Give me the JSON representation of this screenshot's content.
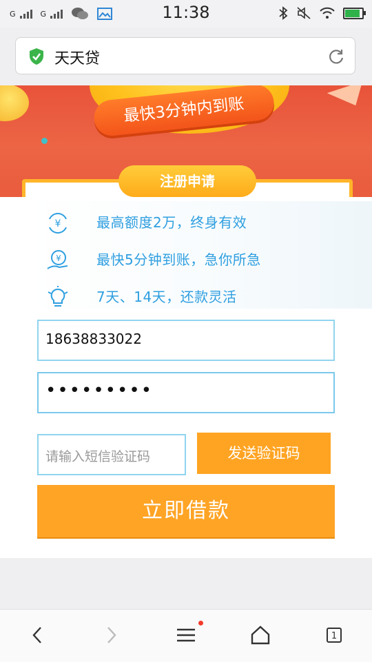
{
  "status_bar": {
    "carrier_1": "G",
    "carrier_2": "G",
    "time": "11:38"
  },
  "browser": {
    "title": "天天贷"
  },
  "banner": {
    "ribbon_text": "最快3分钟内到账",
    "tab_label": "注册申请"
  },
  "features": [
    {
      "icon": "yen-cycle-icon",
      "text": "最高额度2万，终身有效"
    },
    {
      "icon": "yen-hand-icon",
      "text": "最快5分钟到账，急你所急"
    },
    {
      "icon": "lightbulb-icon",
      "text": "7天、14天，还款灵活"
    }
  ],
  "form": {
    "phone_value": "18638833022",
    "password_mask": "•••••••••",
    "sms_placeholder": "请输入短信验证码",
    "send_code_label": "发送验证码",
    "submit_label": "立即借款"
  },
  "bottom_nav": {
    "tab_count": "1"
  },
  "colors": {
    "accent_orange": "#ffa422",
    "feature_blue": "#2f9fe0",
    "input_border": "#8fd4ef"
  }
}
